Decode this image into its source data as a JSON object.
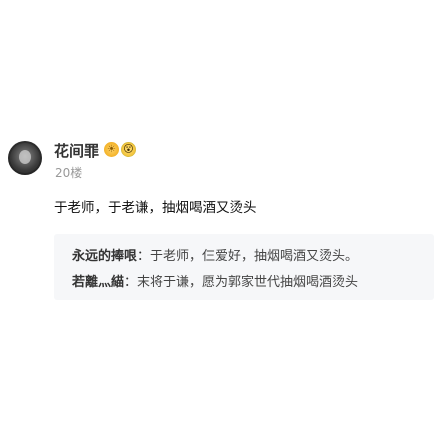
{
  "post": {
    "username": "花间罪",
    "badges": [
      {
        "name": "sun-badge-icon",
        "glyph": "☀"
      },
      {
        "name": "emoji-face-icon",
        "glyph": "😮"
      }
    ],
    "floor": "20楼",
    "content": "于老师，于老谦，抽烟喝酒又烫头"
  },
  "replies": [
    {
      "author": "永远的捧哏",
      "separator": "：",
      "content": "于老师，仨爱好，抽烟喝酒又烫头。"
    },
    {
      "author": "若離灬緢",
      "separator": "：",
      "content": "末将于谦，愿为郭家世代抽烟喝酒烫头"
    }
  ]
}
